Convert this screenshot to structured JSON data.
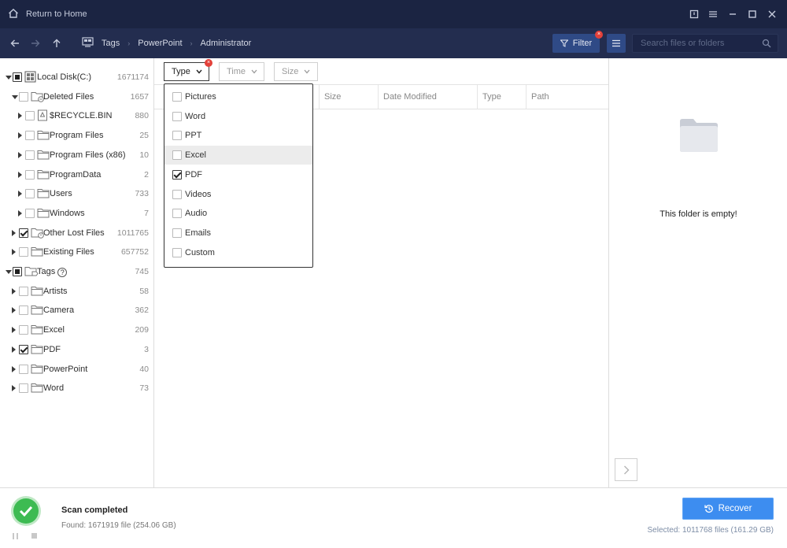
{
  "titlebar": {
    "home_label": "Return to Home"
  },
  "nav": {
    "breadcrumbs": [
      "Tags",
      "PowerPoint",
      "Administrator"
    ],
    "filter_label": "Filter",
    "search_placeholder": "Search files or folders"
  },
  "tree": [
    {
      "label": "Local Disk(C:)",
      "count": "1671174",
      "level": 0,
      "expand": "down",
      "check": "partial",
      "icon": "drive-icon"
    },
    {
      "label": "Deleted Files",
      "count": "1657",
      "level": 1,
      "expand": "down",
      "check": "none",
      "icon": "deleted-folder-icon"
    },
    {
      "label": "$RECYCLE.BIN",
      "count": "880",
      "level": 2,
      "expand": "right",
      "check": "none",
      "icon": "recycle-icon"
    },
    {
      "label": "Program Files",
      "count": "25",
      "level": 2,
      "expand": "right",
      "check": "none",
      "icon": "folder-icon"
    },
    {
      "label": "Program Files (x86)",
      "count": "10",
      "level": 2,
      "expand": "right",
      "check": "none",
      "icon": "folder-icon"
    },
    {
      "label": "ProgramData",
      "count": "2",
      "level": 2,
      "expand": "right",
      "check": "none",
      "icon": "folder-icon"
    },
    {
      "label": "Users",
      "count": "733",
      "level": 2,
      "expand": "right",
      "check": "none",
      "icon": "folder-icon"
    },
    {
      "label": "Windows",
      "count": "7",
      "level": 2,
      "expand": "right",
      "check": "none",
      "icon": "folder-icon"
    },
    {
      "label": "Other Lost Files",
      "count": "1011765",
      "level": 1,
      "expand": "right",
      "check": "checked",
      "icon": "lost-folder-icon"
    },
    {
      "label": "Existing Files",
      "count": "657752",
      "level": 1,
      "expand": "right",
      "check": "none",
      "icon": "folder-icon"
    },
    {
      "label": "Tags",
      "count": "745",
      "level": 0,
      "expand": "down",
      "check": "partial",
      "icon": "tag-folder-icon",
      "help": "?"
    },
    {
      "label": "Artists",
      "count": "58",
      "level": 1,
      "expand": "right",
      "check": "none",
      "icon": "folder-icon"
    },
    {
      "label": "Camera",
      "count": "362",
      "level": 1,
      "expand": "right",
      "check": "none",
      "icon": "folder-icon"
    },
    {
      "label": "Excel",
      "count": "209",
      "level": 1,
      "expand": "right",
      "check": "none",
      "icon": "folder-icon"
    },
    {
      "label": "PDF",
      "count": "3",
      "level": 1,
      "expand": "right",
      "check": "checked",
      "icon": "folder-icon"
    },
    {
      "label": "PowerPoint",
      "count": "40",
      "level": 1,
      "expand": "right",
      "check": "none",
      "icon": "folder-icon"
    },
    {
      "label": "Word",
      "count": "73",
      "level": 1,
      "expand": "right",
      "check": "none",
      "icon": "folder-icon"
    }
  ],
  "filters": {
    "type": "Type",
    "time": "Time",
    "size": "Size"
  },
  "columns": [
    "Size",
    "Date Modified",
    "Type",
    "Path"
  ],
  "type_options": [
    {
      "label": "Pictures",
      "checked": false,
      "hover": false
    },
    {
      "label": "Word",
      "checked": false,
      "hover": false
    },
    {
      "label": "PPT",
      "checked": false,
      "hover": false
    },
    {
      "label": "Excel",
      "checked": false,
      "hover": true
    },
    {
      "label": "PDF",
      "checked": true,
      "hover": false
    },
    {
      "label": "Videos",
      "checked": false,
      "hover": false
    },
    {
      "label": "Audio",
      "checked": false,
      "hover": false
    },
    {
      "label": "Emails",
      "checked": false,
      "hover": false
    },
    {
      "label": "Custom",
      "checked": false,
      "hover": false
    }
  ],
  "preview": {
    "empty_text": "This folder is empty!"
  },
  "footer": {
    "status_title": "Scan completed",
    "found_text": "Found: 1671919 file (254.06 GB)",
    "recover_label": "Recover",
    "selected_text": "Selected: 1011768 files (161.29 GB)"
  },
  "colors": {
    "titlebar": "#1b2442",
    "navbar": "#232d4f",
    "accent": "#3d8df0",
    "success": "#3dbb52",
    "badge": "#e3413a"
  }
}
